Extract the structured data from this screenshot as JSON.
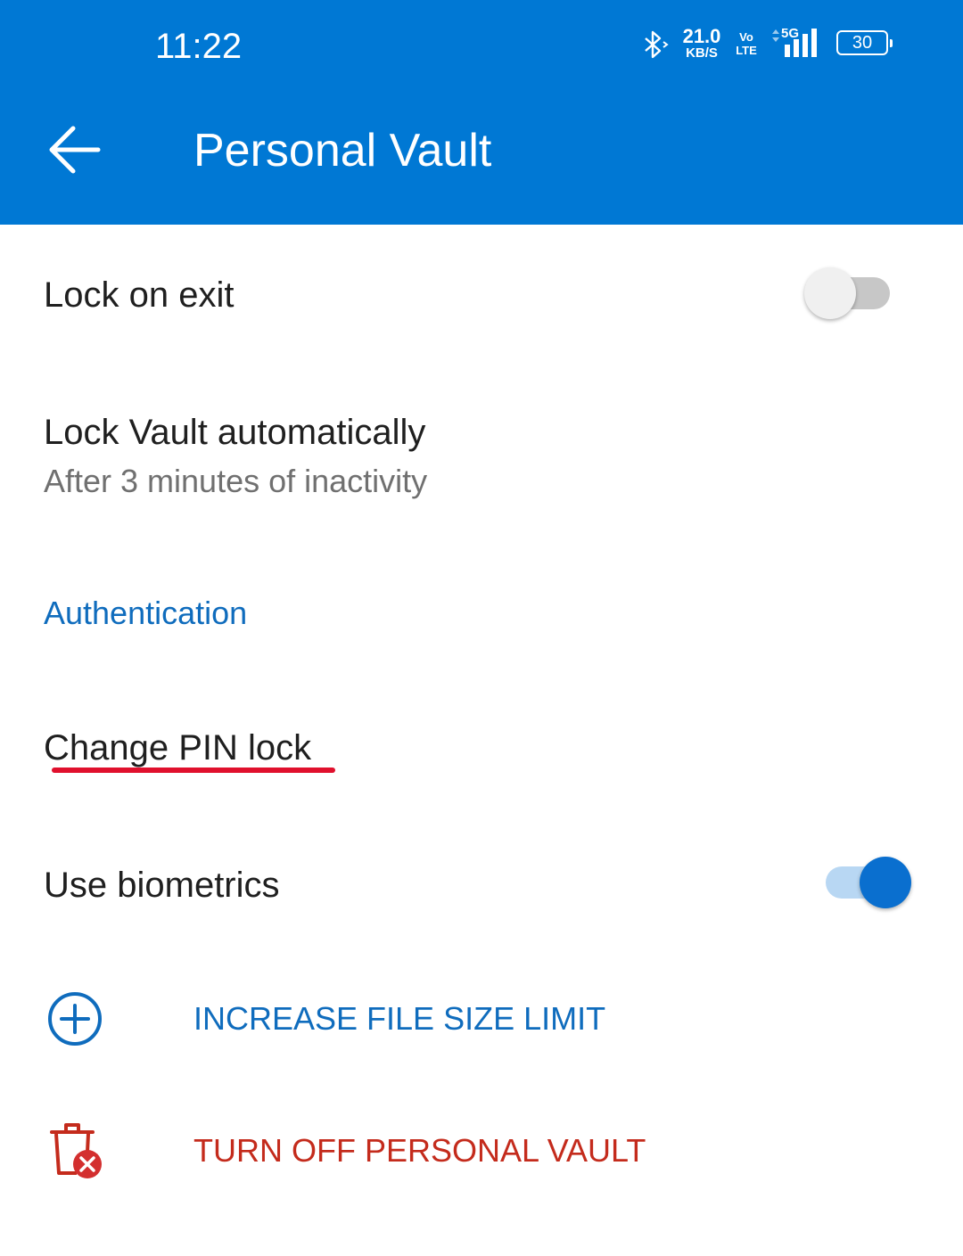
{
  "status_bar": {
    "time": "11:22",
    "net_speed": "21.0",
    "net_speed_unit": "KB/S",
    "volte_top": "Vo",
    "volte_bottom": "LTE",
    "network": "5G",
    "battery": "30"
  },
  "app_bar": {
    "title": "Personal Vault",
    "back_icon": "arrow-left-icon",
    "color": "#0078d4"
  },
  "settings": {
    "lock_on_exit": {
      "label": "Lock on exit",
      "enabled": false
    },
    "lock_automatically": {
      "label": "Lock Vault automatically",
      "sublabel": "After 3 minutes of inactivity"
    },
    "section_authentication": "Authentication",
    "change_pin": {
      "label": "Change PIN lock",
      "annotation_color": "#e0102d"
    },
    "use_biometrics": {
      "label": "Use biometrics",
      "enabled": true
    }
  },
  "actions": {
    "increase_limit": {
      "label": "INCREASE FILE SIZE LIMIT",
      "icon": "plus-circle-icon",
      "color": "#0f6cbd"
    },
    "turn_off": {
      "label": "TURN OFF PERSONAL VAULT",
      "icon": "trash-x-icon",
      "color": "#c42b1c"
    }
  }
}
